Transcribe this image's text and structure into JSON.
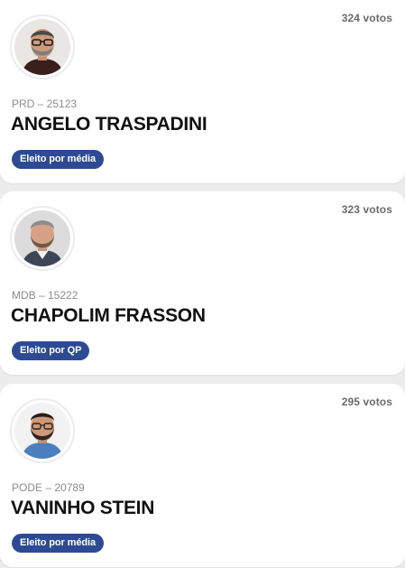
{
  "candidates": [
    {
      "votes": "324 votos",
      "party": "PRD – 25123",
      "name": "ANGELO TRASPADINI",
      "status": "Eleito por média",
      "avatar_icon": "person-photo-icon"
    },
    {
      "votes": "323 votos",
      "party": "MDB – 15222",
      "name": "CHAPOLIM FRASSON",
      "status": "Eleito por QP",
      "avatar_icon": "person-photo-icon"
    },
    {
      "votes": "295 votos",
      "party": "PODE – 20789",
      "name": "VANINHO STEIN",
      "status": "Eleito por média",
      "avatar_icon": "person-photo-icon"
    }
  ],
  "colors": {
    "badge_background": "#2d4b94",
    "page_background": "#ececec",
    "card_background": "#ffffff"
  }
}
